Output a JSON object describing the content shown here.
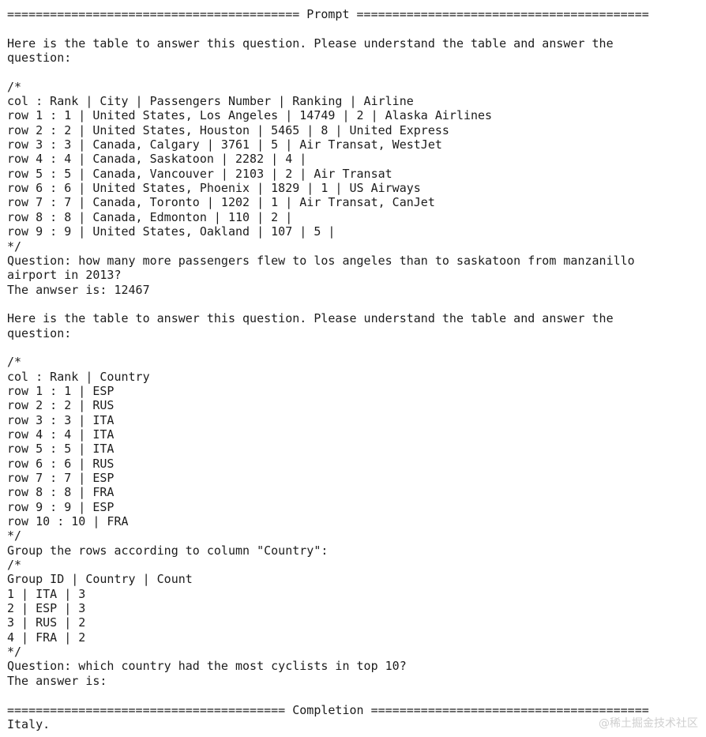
{
  "page": {
    "background_color": "#ffffff",
    "text_color": "#1c1c1c",
    "watermark_color": "#cfcfcf"
  },
  "prompt_section": {
    "separator": "========================================= Prompt =========================================",
    "label": "Prompt"
  },
  "completion_section": {
    "separator": "======================================= Completion =======================================",
    "label": "Completion",
    "output": "Italy."
  },
  "example_one": {
    "instruction_line_1": "Here is the table to answer this question. Please understand the table and answer the",
    "instruction_line_2": "question:",
    "comment_open": "/*",
    "comment_close": "*/",
    "col_header": "col : Rank | City | Passengers Number | Ranking | Airline",
    "rows": [
      "row 1 : 1 | United States, Los Angeles | 14749 | 2 | Alaska Airlines",
      "row 2 : 2 | United States, Houston | 5465 | 8 | United Express",
      "row 3 : 3 | Canada, Calgary | 3761 | 5 | Air Transat, WestJet",
      "row 4 : 4 | Canada, Saskatoon | 2282 | 4 |",
      "row 5 : 5 | Canada, Vancouver | 2103 | 2 | Air Transat",
      "row 6 : 6 | United States, Phoenix | 1829 | 1 | US Airways",
      "row 7 : 7 | Canada, Toronto | 1202 | 1 | Air Transat, CanJet",
      "row 8 : 8 | Canada, Edmonton | 110 | 2 |",
      "row 9 : 9 | United States, Oakland | 107 | 5 |"
    ],
    "question_line_1": "Question: how many more passengers flew to los angeles than to saskatoon from manzanillo",
    "question_line_2": "airport in 2013?",
    "answer": "The anwser is: 12467"
  },
  "example_two": {
    "instruction_line_1": "Here is the table to answer this question. Please understand the table and answer the",
    "instruction_line_2": "question:",
    "comment_open": "/*",
    "comment_close": "*/",
    "col_header": "col : Rank | Country",
    "rows": [
      "row 1 : 1 | ESP",
      "row 2 : 2 | RUS",
      "row 3 : 3 | ITA",
      "row 4 : 4 | ITA",
      "row 5 : 5 | ITA",
      "row 6 : 6 | RUS",
      "row 7 : 7 | ESP",
      "row 8 : 8 | FRA",
      "row 9 : 9 | ESP",
      "row 10 : 10 | FRA"
    ],
    "group_instruction": "Group the rows according to column \"Country\":",
    "group_comment_open": "/*",
    "group_comment_close": "*/",
    "group_header": "Group ID | Country | Count",
    "group_rows": [
      "1 | ITA | 3",
      "2 | ESP | 3",
      "3 | RUS | 2",
      "4 | FRA | 2"
    ],
    "question": "Question: which country had the most cyclists in top 10?",
    "answer_prefix": "The answer is:"
  },
  "watermark": {
    "text": "@稀土掘金技术社区"
  }
}
